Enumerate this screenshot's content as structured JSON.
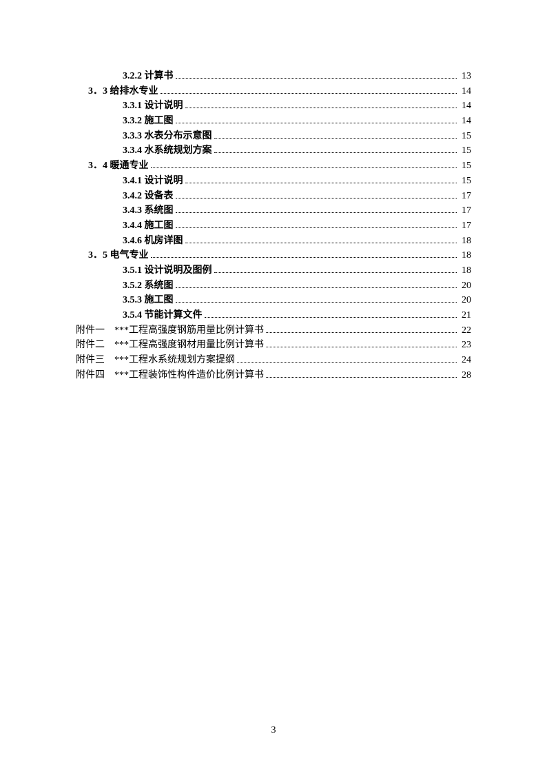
{
  "toc": {
    "entries": [
      {
        "indent": 2,
        "bold": true,
        "num": "3.2.2 ",
        "title": "计算书",
        "page": "13"
      },
      {
        "indent": 1,
        "bold": true,
        "num": "3．3 ",
        "title": "给排水专业",
        "page": "14"
      },
      {
        "indent": 2,
        "bold": true,
        "num": "3.3.1 ",
        "title": "设计说明",
        "page": "14"
      },
      {
        "indent": 2,
        "bold": true,
        "num": "3.3.2 ",
        "title": "施工图",
        "page": "14"
      },
      {
        "indent": 2,
        "bold": true,
        "num": "3.3.3 ",
        "title": "水表分布示意图",
        "page": "15"
      },
      {
        "indent": 2,
        "bold": true,
        "num": "3.3.4 ",
        "title": "水系统规划方案",
        "page": "15"
      },
      {
        "indent": 1,
        "bold": true,
        "num": "3．4 ",
        "title": "暖通专业",
        "page": "15"
      },
      {
        "indent": 2,
        "bold": true,
        "num": "3.4.1 ",
        "title": "设计说明",
        "page": "15"
      },
      {
        "indent": 2,
        "bold": true,
        "num": "3.4.2 ",
        "title": "设备表",
        "page": "17"
      },
      {
        "indent": 2,
        "bold": true,
        "num": "3.4.3 ",
        "title": "系统图",
        "page": "17"
      },
      {
        "indent": 2,
        "bold": true,
        "num": "3.4.4 ",
        "title": "施工图",
        "page": "17"
      },
      {
        "indent": 2,
        "bold": true,
        "num": "3.4.6 ",
        "title": "机房详图",
        "page": "18"
      },
      {
        "indent": 1,
        "bold": true,
        "num": "3．5 ",
        "title": "电气专业",
        "page": "18"
      },
      {
        "indent": 2,
        "bold": true,
        "num": "3.5.1 ",
        "title": "设计说明及图例",
        "page": "18"
      },
      {
        "indent": 2,
        "bold": true,
        "num": "3.5.2 ",
        "title": "系统图",
        "page": "20"
      },
      {
        "indent": 2,
        "bold": true,
        "num": "3.5.3 ",
        "title": "施工图",
        "page": "20"
      },
      {
        "indent": 2,
        "bold": true,
        "num": "3.5.4 ",
        "title": "节能计算文件",
        "page": "21"
      }
    ],
    "appendix": [
      {
        "prefix": "附件一",
        "title": "***工程高强度钢筋用量比例计算书",
        "page": "22"
      },
      {
        "prefix": "附件二",
        "title": "***工程高强度钢材用量比例计算书",
        "page": "23"
      },
      {
        "prefix": "附件三",
        "title": "***工程水系统规划方案提纲",
        "page": "24"
      },
      {
        "prefix": "附件四",
        "title": "***工程装饰性构件造价比例计算书",
        "page": "28"
      }
    ]
  },
  "page_number": "3"
}
